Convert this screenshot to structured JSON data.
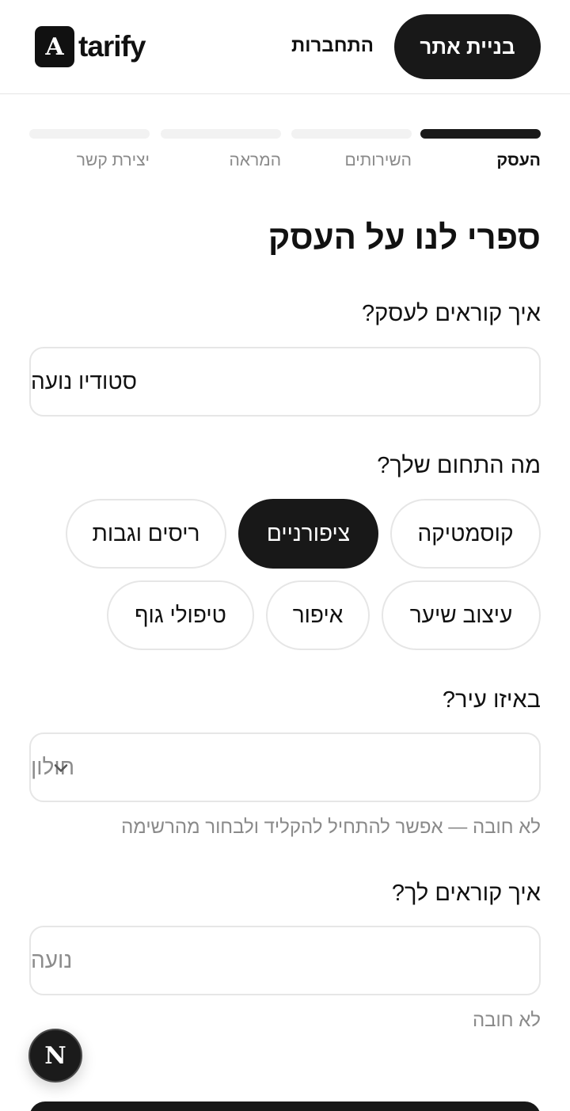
{
  "header": {
    "logo_mark": "A",
    "logo_text": "tarify",
    "login_label": "התחברות",
    "cta_label": "בניית אתר"
  },
  "steps": [
    {
      "label": "העסק",
      "active": true
    },
    {
      "label": "השירותים",
      "active": false
    },
    {
      "label": "המראה",
      "active": false
    },
    {
      "label": "יצירת קשר",
      "active": false
    }
  ],
  "form": {
    "title": "ספרי לנו על העסק",
    "business_name": {
      "label": "איך קוראים לעסק?",
      "value": "סטודיו נועה"
    },
    "field": {
      "label": "מה התחום שלך?",
      "options": [
        "קוסמטיקה",
        "ציפורניים",
        "ריסים וגבות",
        "עיצוב שיער",
        "איפור",
        "טיפולי גוף"
      ],
      "selected": "ציפורניים"
    },
    "city": {
      "label": "באיזו עיר?",
      "placeholder": "חולון",
      "hint": "לא חובה — אפשר להתחיל להקליד ולבחור מהרשימה"
    },
    "owner_name": {
      "label": "איך קוראים לך?",
      "placeholder": "נועה",
      "hint": "לא חובה"
    }
  },
  "badge": {
    "letter": "N"
  },
  "colors": {
    "primary": "#181818",
    "border": "#e6e6e6",
    "muted": "#8a8a8a"
  }
}
